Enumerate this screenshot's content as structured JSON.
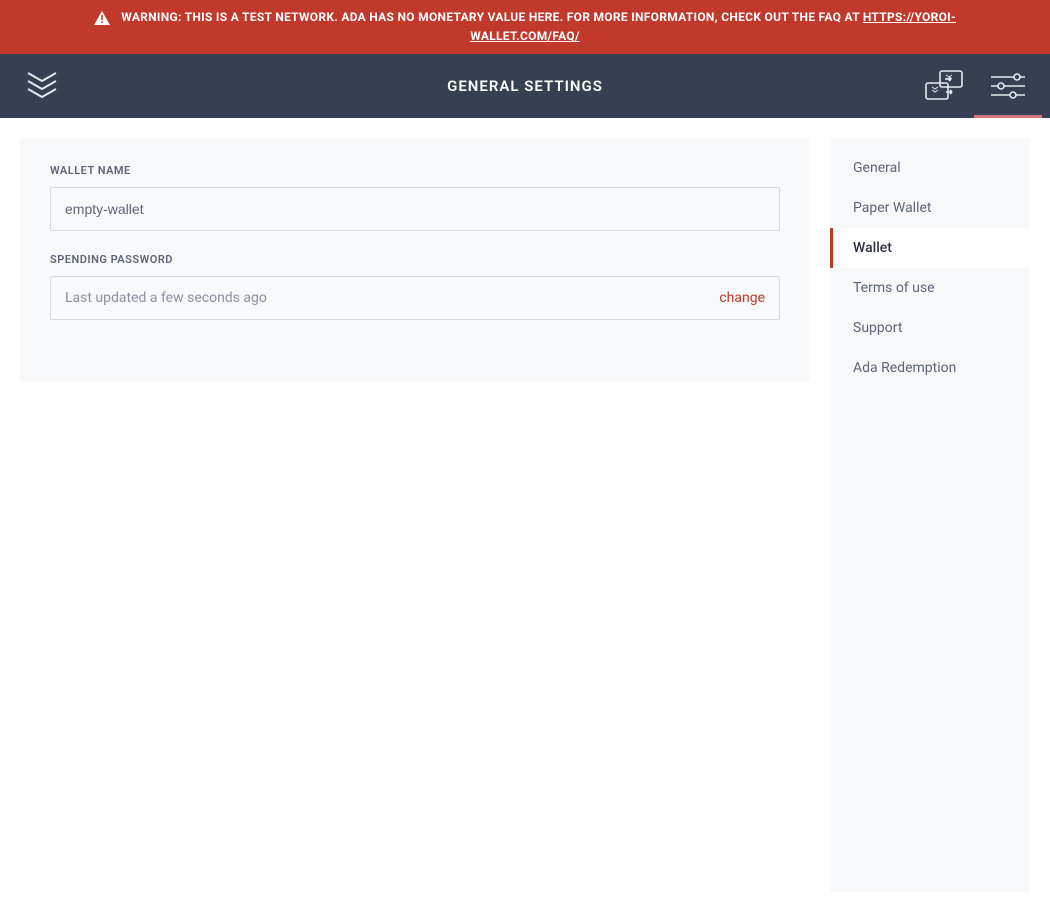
{
  "banner": {
    "text_prefix": "Warning: This is a test network. ADA has no monetary value here. For more information, check out the FAQ at ",
    "link_text": "https://yoroi-wallet.com/faq/"
  },
  "header": {
    "title": "General Settings"
  },
  "form": {
    "wallet_name_label": "Wallet Name",
    "wallet_name_value": "empty-wallet",
    "spending_password_label": "Spending Password",
    "spending_password_status": "Last updated a few seconds ago",
    "spending_password_action": "change"
  },
  "sidebar": {
    "items": [
      {
        "label": "General"
      },
      {
        "label": "Paper Wallet"
      },
      {
        "label": "Wallet"
      },
      {
        "label": "Terms of use"
      },
      {
        "label": "Support"
      },
      {
        "label": "Ada Redemption"
      }
    ],
    "active_index": 2
  },
  "colors": {
    "banner_bg": "#c0392b",
    "topbar_bg": "#373f52",
    "panel_bg": "#f8f9fb",
    "accent": "#c0392b"
  }
}
